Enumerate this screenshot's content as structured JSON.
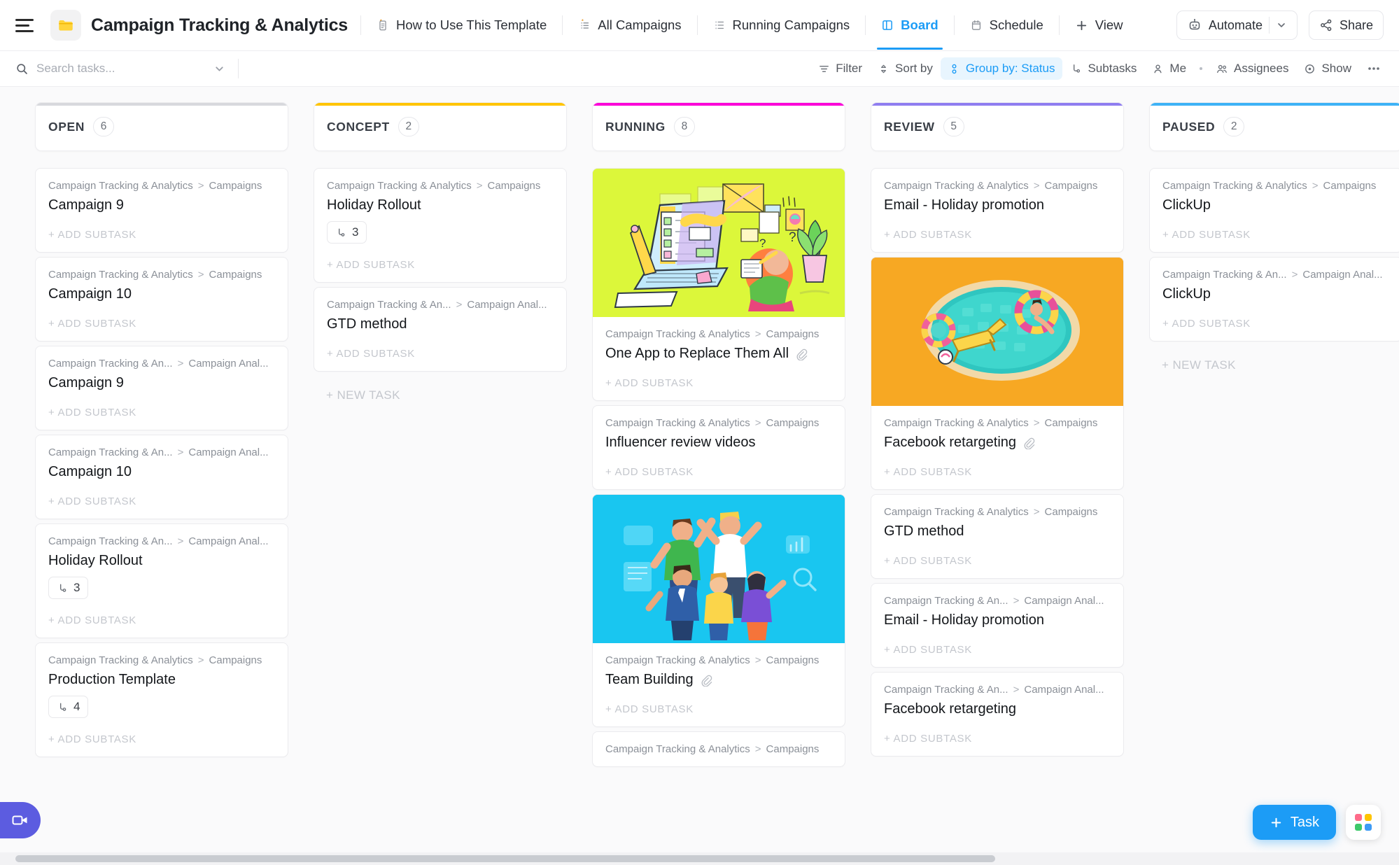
{
  "topbar": {
    "menu_icon": "hamburger-icon",
    "folder_icon": "folder-icon",
    "space_title": "Campaign Tracking & Analytics",
    "views": [
      {
        "label": "How to Use This Template",
        "icon": "doc-pinned-icon",
        "active": false
      },
      {
        "label": "All Campaigns",
        "icon": "list-pinned-icon",
        "active": false
      },
      {
        "label": "Running Campaigns",
        "icon": "list-icon",
        "active": false
      },
      {
        "label": "Board",
        "icon": "board-icon",
        "active": true
      },
      {
        "label": "Schedule",
        "icon": "calendar-icon",
        "active": false
      },
      {
        "label": "View",
        "icon": "plus-icon",
        "active": false
      }
    ],
    "automate_label": "Automate",
    "automate_icon": "robot-icon",
    "automate_chevron": "chevron-down-icon",
    "share_label": "Share",
    "share_icon": "share-icon"
  },
  "toolbar": {
    "search_placeholder": "Search tasks...",
    "search_value": "",
    "search_icon": "search-icon",
    "search_chevron": "chevron-down-icon",
    "items": [
      {
        "label": "Filter",
        "icon": "filter-icon",
        "highlight": false
      },
      {
        "label": "Sort by",
        "icon": "sort-icon",
        "highlight": false
      },
      {
        "label": "Group by: Status",
        "icon": "group-icon",
        "highlight": true
      },
      {
        "label": "Subtasks",
        "icon": "subtask-icon",
        "highlight": false
      },
      {
        "label": "Me",
        "icon": "person-icon",
        "highlight": false
      },
      {
        "label": "Assignees",
        "icon": "people-icon",
        "highlight": false
      },
      {
        "label": "Show",
        "icon": "eye-icon",
        "highlight": false
      }
    ],
    "more_icon": "ellipsis-icon"
  },
  "board": {
    "add_subtask_label": "+ ADD SUBTASK",
    "new_task_label": "+ NEW TASK",
    "columns": [
      {
        "name": "OPEN",
        "count": "6",
        "color": "#d8d9dd",
        "show_new_task": false,
        "cards": [
          {
            "crumb_left": "Campaign Tracking & Analytics",
            "crumb_right": "Campaigns",
            "title": "Campaign 9",
            "subtasks": "",
            "attachment": false,
            "cover": "none"
          },
          {
            "crumb_left": "Campaign Tracking & Analytics",
            "crumb_right": "Campaigns",
            "title": "Campaign 10",
            "subtasks": "",
            "attachment": false,
            "cover": "none"
          },
          {
            "crumb_left": "Campaign Tracking & An...",
            "crumb_right": "Campaign Anal...",
            "title": "Campaign 9",
            "subtasks": "",
            "attachment": false,
            "cover": "none"
          },
          {
            "crumb_left": "Campaign Tracking & An...",
            "crumb_right": "Campaign Anal...",
            "title": "Campaign 10",
            "subtasks": "",
            "attachment": false,
            "cover": "none"
          },
          {
            "crumb_left": "Campaign Tracking & An...",
            "crumb_right": "Campaign Anal...",
            "title": "Holiday Rollout",
            "subtasks": "3",
            "attachment": false,
            "cover": "none"
          },
          {
            "crumb_left": "Campaign Tracking & Analytics",
            "crumb_right": "Campaigns",
            "title": "Production Template",
            "subtasks": "4",
            "attachment": false,
            "cover": "none"
          }
        ]
      },
      {
        "name": "CONCEPT",
        "count": "2",
        "color": "#ffc400",
        "show_new_task": true,
        "cards": [
          {
            "crumb_left": "Campaign Tracking & Analytics",
            "crumb_right": "Campaigns",
            "title": "Holiday Rollout",
            "subtasks": "3",
            "attachment": false,
            "cover": "none"
          },
          {
            "crumb_left": "Campaign Tracking & An...",
            "crumb_right": "Campaign Anal...",
            "title": "GTD method",
            "subtasks": "",
            "attachment": false,
            "cover": "none"
          }
        ]
      },
      {
        "name": "RUNNING",
        "count": "8",
        "color": "#fb00d8",
        "show_new_task": false,
        "cards": [
          {
            "crumb_left": "Campaign Tracking & Analytics",
            "crumb_right": "Campaigns",
            "title": "One App to Replace Them All",
            "subtasks": "",
            "attachment": true,
            "cover": "laptop-illustration"
          },
          {
            "crumb_left": "Campaign Tracking & Analytics",
            "crumb_right": "Campaigns",
            "title": "Influencer review videos",
            "subtasks": "",
            "attachment": false,
            "cover": "none"
          },
          {
            "crumb_left": "Campaign Tracking & Analytics",
            "crumb_right": "Campaigns",
            "title": "Team Building",
            "subtasks": "",
            "attachment": true,
            "cover": "team-illustration"
          },
          {
            "crumb_left": "Campaign Tracking & Analytics",
            "crumb_right": "Campaigns",
            "title": "",
            "subtasks": "",
            "attachment": false,
            "cover": "none"
          }
        ]
      },
      {
        "name": "REVIEW",
        "count": "5",
        "color": "#8f7df0",
        "show_new_task": false,
        "cards": [
          {
            "crumb_left": "Campaign Tracking & Analytics",
            "crumb_right": "Campaigns",
            "title": "Email - Holiday promotion",
            "subtasks": "",
            "attachment": false,
            "cover": "none"
          },
          {
            "crumb_left": "Campaign Tracking & Analytics",
            "crumb_right": "Campaigns",
            "title": "Facebook retargeting",
            "subtasks": "",
            "attachment": true,
            "cover": "pool-illustration"
          },
          {
            "crumb_left": "Campaign Tracking & Analytics",
            "crumb_right": "Campaigns",
            "title": "GTD method",
            "subtasks": "",
            "attachment": false,
            "cover": "none"
          },
          {
            "crumb_left": "Campaign Tracking & An...",
            "crumb_right": "Campaign Anal...",
            "title": "Email - Holiday promotion",
            "subtasks": "",
            "attachment": false,
            "cover": "none"
          },
          {
            "crumb_left": "Campaign Tracking & An...",
            "crumb_right": "Campaign Anal...",
            "title": "Facebook retargeting",
            "subtasks": "",
            "attachment": false,
            "cover": "none"
          }
        ]
      },
      {
        "name": "PAUSED",
        "count": "2",
        "color": "#3eb2f6",
        "show_new_task": true,
        "cards": [
          {
            "crumb_left": "Campaign Tracking & Analytics",
            "crumb_right": "Campaigns",
            "title": "ClickUp",
            "subtasks": "",
            "attachment": false,
            "cover": "none"
          },
          {
            "crumb_left": "Campaign Tracking & An...",
            "crumb_right": "Campaign Anal...",
            "title": "ClickUp",
            "subtasks": "",
            "attachment": false,
            "cover": "none"
          }
        ]
      }
    ]
  },
  "floating": {
    "clip_icon": "video-camera-icon",
    "task_label": "Task",
    "task_icon": "plus-icon",
    "apps_icon": "apps-grid-icon",
    "apps_colors": [
      "#ff6b8a",
      "#ffc400",
      "#3ec96b",
      "#3d9bf5"
    ]
  },
  "colors": {
    "accent": "#1c9cf6",
    "text": "#13161a",
    "muted": "#8b9098",
    "board_bg": "#fafafb"
  }
}
